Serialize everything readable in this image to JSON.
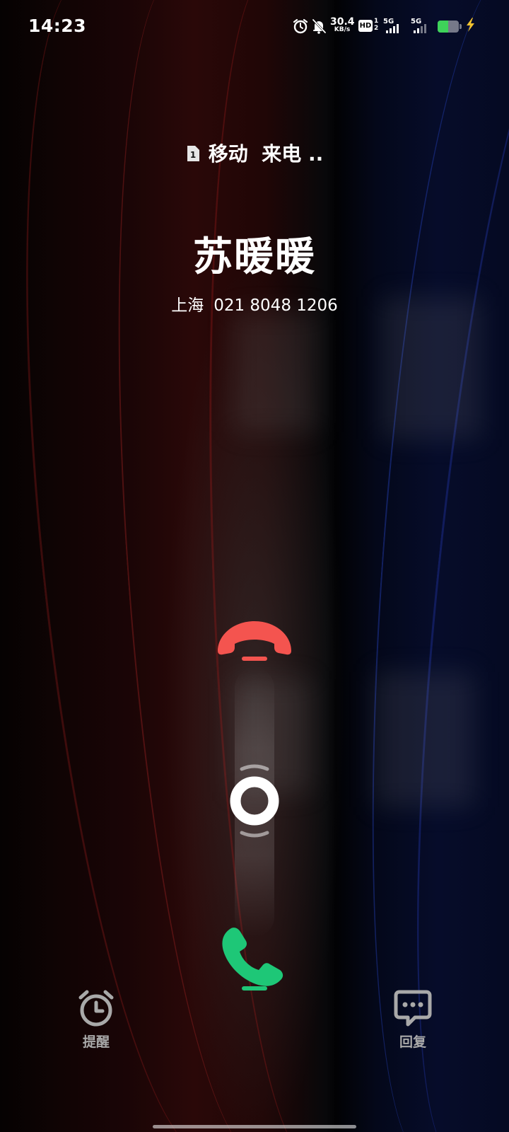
{
  "status_bar": {
    "time": "14:23",
    "net_speed_value": "30.4",
    "net_speed_unit": "KB/s",
    "hd_label": "HD",
    "hd_sim_top": "1",
    "hd_sim_bottom": "2",
    "signal_1_type": "5G",
    "signal_2_type": "5G",
    "battery_level": 0.5,
    "icons": [
      "alarm-icon",
      "mute-bell-icon",
      "hd-voice-icon",
      "signal-icon",
      "battery-icon",
      "charging-icon"
    ]
  },
  "call": {
    "sim_label": "1",
    "carrier": "移动",
    "status": "来电 ..",
    "caller_name": "苏暖暖",
    "location": "上海",
    "number": "021 8048 1206"
  },
  "actions": {
    "remind_label": "提醒",
    "reply_label": "回复"
  },
  "colors": {
    "decline": "#f4544f",
    "accept": "#1ec777",
    "battery": "#3ed35a",
    "charging": "#f2c230",
    "secondary_text": "#a9a9a9"
  }
}
